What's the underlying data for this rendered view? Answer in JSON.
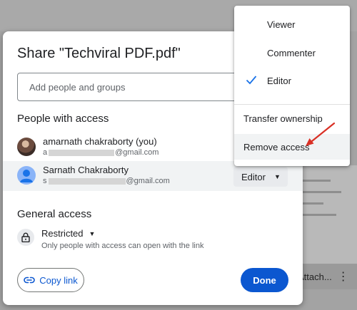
{
  "dialog": {
    "title": "Share \"Techviral PDF.pdf\"",
    "add_people_placeholder": "Add people and groups",
    "people_section_title": "People with access",
    "people": [
      {
        "name": "amarnath chakraborty (you)",
        "email_prefix": "a",
        "email_suffix": "@gmail.com"
      },
      {
        "name": "Sarnath Chakraborty",
        "email_prefix": "s",
        "email_suffix": "@gmail.com",
        "role": "Editor"
      }
    ],
    "general_access_title": "General access",
    "general_access_value": "Restricted",
    "general_access_description": "Only people with access can open with the link",
    "copy_link_label": "Copy link",
    "done_label": "Done"
  },
  "role_menu": {
    "options": [
      "Viewer",
      "Commenter",
      "Editor"
    ],
    "selected": "Editor",
    "transfer_ownership": "Transfer ownership",
    "remove_access": "Remove access"
  },
  "background": {
    "file_label": "Attach..."
  },
  "colors": {
    "accent": "#0b57d0",
    "annotation_arrow": "#d93025",
    "hover_row": "#f1f3f4"
  }
}
